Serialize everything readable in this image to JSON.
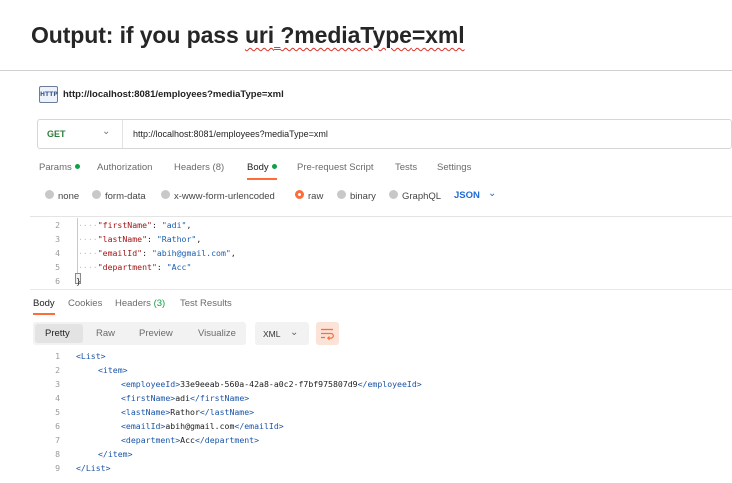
{
  "heading": {
    "prefix": "Output: if you pass ",
    "uri": "uri",
    "space": " ",
    "media": "?mediaType",
    "suffix": "=xml"
  },
  "request": {
    "icon_text": "HTTP",
    "title": "http://localhost:8081/employees?mediaType=xml",
    "method": "GET",
    "url": "http://localhost:8081/employees?mediaType=xml"
  },
  "request_tabs": [
    {
      "label": "Params",
      "dot": true
    },
    {
      "label": "Authorization"
    },
    {
      "label": "Headers (8)"
    },
    {
      "label": "Body",
      "dot": true,
      "active": true
    },
    {
      "label": "Pre-request Script"
    },
    {
      "label": "Tests"
    },
    {
      "label": "Settings"
    }
  ],
  "body_types": [
    {
      "label": "none"
    },
    {
      "label": "form-data"
    },
    {
      "label": "x-www-form-urlencoded"
    },
    {
      "label": "raw",
      "selected": true
    },
    {
      "label": "binary"
    },
    {
      "label": "GraphQL"
    }
  ],
  "body_format": "JSON",
  "request_body": {
    "line_numbers": [
      "2",
      "3",
      "4",
      "5",
      "6"
    ],
    "lines": [
      {
        "indent": "····",
        "key": "\"firstName\"",
        "sep": ": ",
        "value": "\"adi\"",
        "end": ","
      },
      {
        "indent": "····",
        "key": "\"lastName\"",
        "sep": ": ",
        "value": "\"Rathor\"",
        "end": ","
      },
      {
        "indent": "····",
        "key": "\"emailId\"",
        "sep": ": ",
        "value": "\"abih@gmail.com\"",
        "end": ","
      },
      {
        "indent": "····",
        "key": "\"department\"",
        "sep": ": ",
        "value": "\"Acc\"",
        "end": ""
      }
    ],
    "closing": "}"
  },
  "response_tabs": [
    {
      "label": "Body",
      "active": true
    },
    {
      "label": "Cookies"
    },
    {
      "label": "Headers",
      "count": "(3)"
    },
    {
      "label": "Test Results"
    }
  ],
  "view_modes": [
    {
      "label": "Pretty",
      "active": true
    },
    {
      "label": "Raw"
    },
    {
      "label": "Preview"
    },
    {
      "label": "Visualize"
    }
  ],
  "response_format": "XML",
  "response_body": {
    "line_numbers": [
      "1",
      "2",
      "3",
      "4",
      "5",
      "6",
      "7",
      "8",
      "9"
    ],
    "lines": [
      {
        "open": "<List>"
      },
      {
        "open": "<item>"
      },
      {
        "open": "<employeeId>",
        "text": "33e9eeab-560a-42a8-a0c2-f7bf975807d9",
        "close": "</employeeId>"
      },
      {
        "open": "<firstName>",
        "text": "adi",
        "close": "</firstName>"
      },
      {
        "open": "<lastName>",
        "text": "Rathor",
        "close": "</lastName>"
      },
      {
        "open": "<emailId>",
        "text": "abih@gmail.com",
        "close": "</emailId>"
      },
      {
        "open": "<department>",
        "text": "Acc",
        "close": "</department>"
      },
      {
        "open": "</item>"
      },
      {
        "open": "</List>"
      }
    ]
  },
  "colors": {
    "accent": "#ff6c37",
    "get_method": "#2f7d3b",
    "status_dot": "#10a04a",
    "xml_tag": "#1a55a8",
    "json_key": "#a31515",
    "json_string": "#1a5fb4"
  }
}
